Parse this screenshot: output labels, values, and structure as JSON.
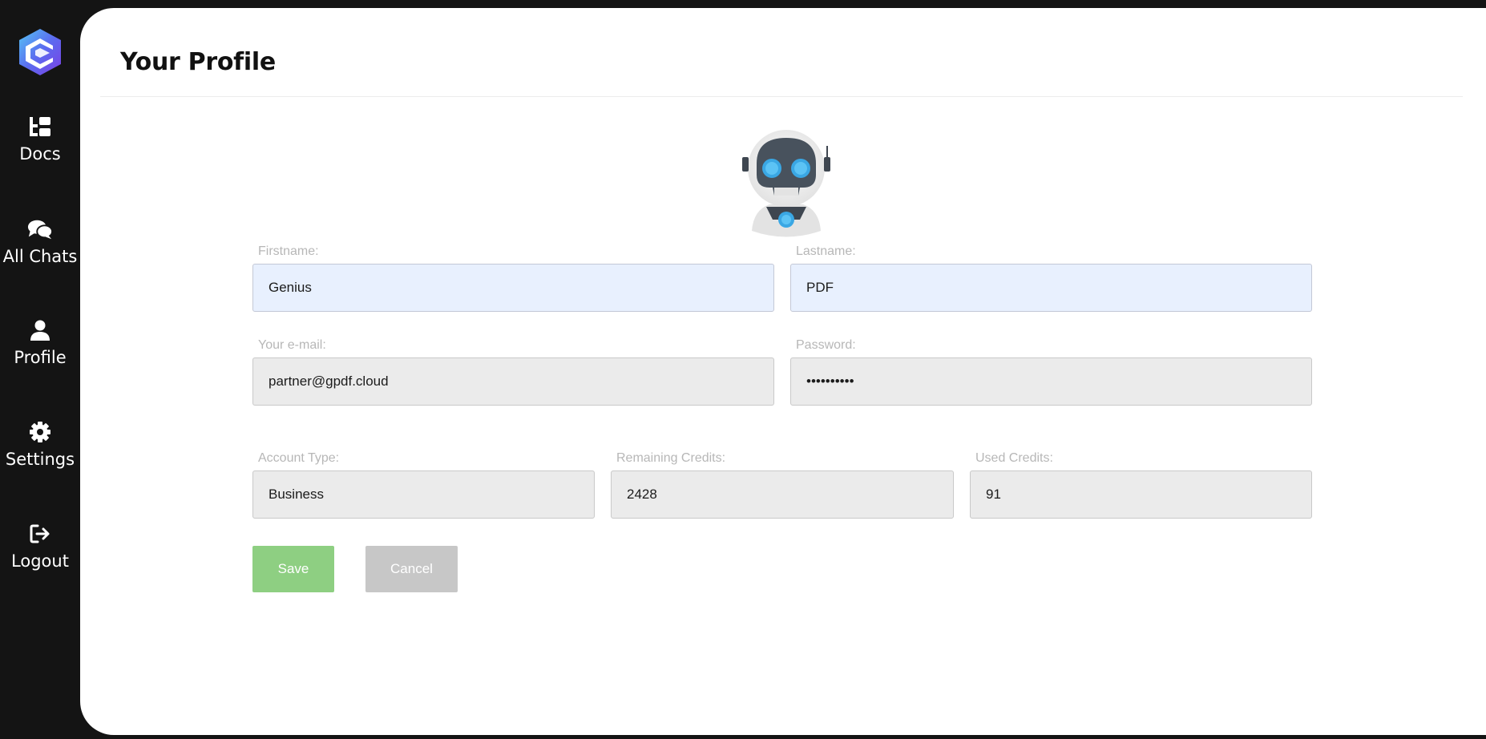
{
  "sidebar": {
    "items": [
      {
        "label": "Docs",
        "icon": "docs-icon"
      },
      {
        "label": "All Chats",
        "icon": "chats-icon"
      },
      {
        "label": "Profile",
        "icon": "user-icon"
      },
      {
        "label": "Settings",
        "icon": "gear-icon"
      },
      {
        "label": "Logout",
        "icon": "logout-icon"
      }
    ]
  },
  "header": {
    "title": "Your Profile"
  },
  "form": {
    "firstname": {
      "label": "Firstname:",
      "value": "Genius"
    },
    "lastname": {
      "label": "Lastname:",
      "value": "PDF"
    },
    "email": {
      "label": "Your e-mail:",
      "value": "partner@gpdf.cloud"
    },
    "password": {
      "label": "Password:",
      "value": "••••••••••"
    },
    "account_type": {
      "label": "Account Type:",
      "value": "Business"
    },
    "remaining_credits": {
      "label": "Remaining Credits:",
      "value": "2428"
    },
    "used_credits": {
      "label": "Used Credits:",
      "value": "91"
    }
  },
  "actions": {
    "save_label": "Save",
    "cancel_label": "Cancel"
  },
  "colors": {
    "sidebar_bg": "#141414",
    "save_button": "#8ecf82",
    "cancel_button": "#c7c7c7",
    "autofill_bg": "#e8f0fe",
    "input_bg": "#ebebeb"
  }
}
